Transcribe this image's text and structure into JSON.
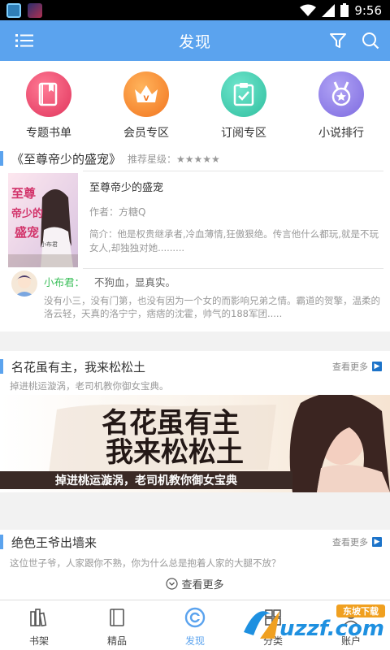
{
  "status_bar": {
    "time": "9:56"
  },
  "header": {
    "title": "发现"
  },
  "categories": [
    {
      "label": "专题书单",
      "icon": "book-icon",
      "color": "#e94a6d"
    },
    {
      "label": "会员专区",
      "icon": "crown-icon",
      "color": "#f68a2c"
    },
    {
      "label": "订阅专区",
      "icon": "clipboard-check-icon",
      "color": "#3dccb0"
    },
    {
      "label": "小说排行",
      "icon": "medal-icon",
      "color": "#8c7ae6"
    }
  ],
  "featured": {
    "title": "《至尊帝少的盛宠》",
    "rating_label": "推荐星级：★★★★★",
    "cover_text": {
      "title_line1": "至尊",
      "title_line2": "帝少的",
      "title_line3": "盛宠",
      "author": "小布君"
    },
    "book_title": "至尊帝少的盛宠",
    "author": "作者：方糖Q",
    "description": "简介：他是权贵继承者,冷血薄情,狂傲狠绝。传言他什么都玩,就是不玩女人,却独独对她.........",
    "review": {
      "user": "小布君：",
      "text": "不狗血，显真实。",
      "body": "没有小三，没有门第，也没有因为一个女的而影响兄弟之情。霸道的贺擎，温柔的洛云轻，天真的洛宁宁，痞痞的沈霍，帅气的188军团....."
    }
  },
  "section2": {
    "title": "名花虽有主，我来松松土",
    "more_label": "查看更多",
    "subtitle": "掉进桃运漩涡，老司机教你御女宝典。",
    "banner": {
      "line1": "名花虽有主",
      "line2": "我来松松土",
      "tagline": "掉进桃运漩涡，老司机教你御女宝典"
    }
  },
  "section3": {
    "title": "绝色王爷出墙来",
    "more_label": "查看更多",
    "subtitle": "这位世子爷，人家跟你不熟，你为什么总是抱着人家的大腿不放？",
    "view_more": "查看更多"
  },
  "tabs": [
    {
      "label": "书架",
      "icon": "bookshelf-icon",
      "active": false
    },
    {
      "label": "精品",
      "icon": "book-icon",
      "active": false
    },
    {
      "label": "发现",
      "icon": "discover-icon",
      "active": true
    },
    {
      "label": "分类",
      "icon": "category-icon",
      "active": false
    },
    {
      "label": "账户",
      "icon": "account-icon",
      "active": false
    }
  ],
  "watermark": {
    "text": "uzzf.com",
    "sub": "东坡下载"
  },
  "colors": {
    "primary": "#5ba3ee",
    "accent": "#1c73c9",
    "review_user": "#3bbf5a"
  }
}
